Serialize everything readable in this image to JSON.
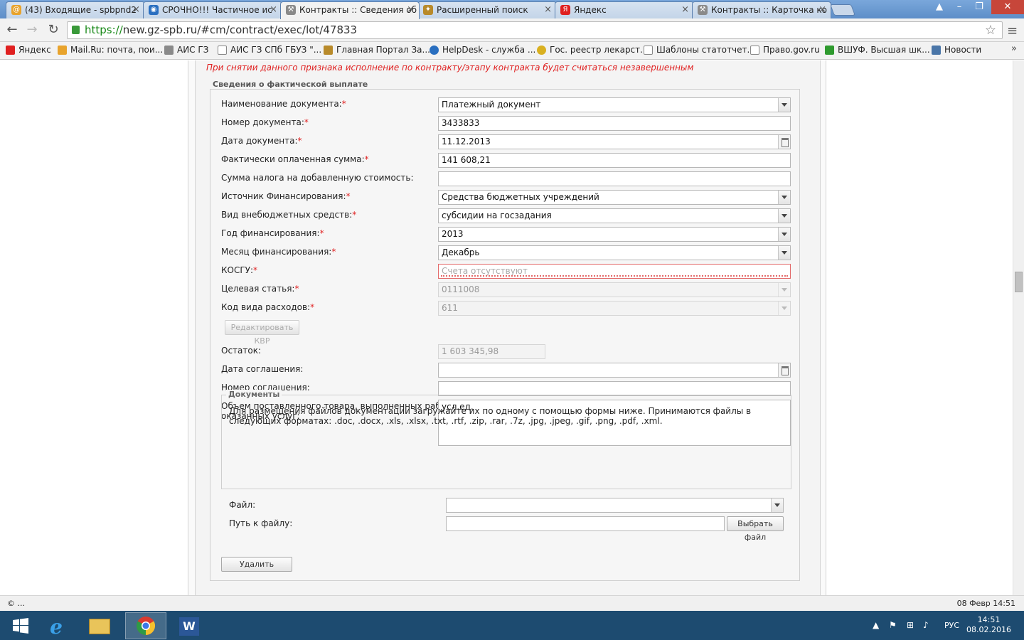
{
  "browser": {
    "tabs": [
      {
        "title": "(43) Входящие - spbpnd2",
        "favicon": "mail-icon",
        "color": "#e8a32c"
      },
      {
        "title": "СРОЧНО!!! Частичное ис",
        "favicon": "helpdesk-icon",
        "color": "#2a6fc0"
      },
      {
        "title": "Контракты :: Сведения об",
        "favicon": "tools-icon",
        "color": "#8a8a8a",
        "active": true
      },
      {
        "title": "Расширенный поиск",
        "favicon": "eagle-icon",
        "color": "#b88a2a"
      },
      {
        "title": "Яндекс",
        "favicon": "yandex-icon",
        "color": "#e02020"
      },
      {
        "title": "Контракты :: Карточка ко",
        "favicon": "tools-icon",
        "color": "#8a8a8a"
      }
    ],
    "url_scheme": "https://",
    "url_rest": "new.gz-spb.ru/#cm/contract/exec/lot/47833",
    "bookmarks": [
      {
        "label": "Яндекс",
        "color": "#e02020"
      },
      {
        "label": "Mail.Ru: почта, пои...",
        "color": "#e8a32c"
      },
      {
        "label": "АИС ГЗ",
        "color": "#8a8a8a"
      },
      {
        "label": "АИС ГЗ СПб ГБУЗ \"...",
        "color": "#ffffff"
      },
      {
        "label": "Главная Портал За...",
        "color": "#b88a2a"
      },
      {
        "label": "HelpDesk - служба ...",
        "color": "#2a6fc0"
      },
      {
        "label": "Гос. реестр лекарст...",
        "color": "#d9b020"
      },
      {
        "label": "Шаблоны статотчет...",
        "color": "#ffffff"
      },
      {
        "label": "Право.gov.ru",
        "color": "#ffffff"
      },
      {
        "label": "ВШУФ. Высшая шк...",
        "color": "#2e9a2e"
      },
      {
        "label": "Новости",
        "color": "#4a76a8"
      }
    ],
    "more": "»"
  },
  "page": {
    "warning": "При снятии данного признака исполнение по контракту/этапу контракта будет считаться незавершенным",
    "section_title": "Сведения о фактической выплате",
    "fields": {
      "doc_name": {
        "label": "Наименование документа:",
        "value": "Платежный документ"
      },
      "doc_number": {
        "label": "Номер документа:",
        "value": "3433833"
      },
      "doc_date": {
        "label": "Дата документа:",
        "value": "11.12.2013"
      },
      "paid_sum": {
        "label": "Фактически оплаченная сумма:",
        "value": "141 608,21"
      },
      "vat_sum": {
        "label": "Сумма налога на добавленную стоимость:",
        "value": ""
      },
      "fin_source": {
        "label": "Источник Финансирования:",
        "value": "Средства бюджетных учреждений"
      },
      "extra_budget": {
        "label": "Вид внебюджетных средств:",
        "value": "субсидии на госзадания"
      },
      "fin_year": {
        "label": "Год финансирования:",
        "value": "2013"
      },
      "fin_month": {
        "label": "Месяц финансирования:",
        "value": "Декабрь"
      },
      "kosgu": {
        "label": "КОСГУ:",
        "value": "Счета отсутствуют"
      },
      "target_article": {
        "label": "Целевая статья:",
        "value": "0111008"
      },
      "expense_code": {
        "label": "Код вида расходов:",
        "value": "611"
      },
      "remainder": {
        "label": "Остаток:",
        "value": "1 603 345,98"
      },
      "agreement_date": {
        "label": "Дата соглашения:",
        "value": ""
      },
      "agreement_number": {
        "label": "Номер соглашения:",
        "value": ""
      },
      "volume_line1": {
        "label": "Объем поставленного товара, выполненных работ,",
        "value": "усл.ед."
      },
      "volume_line2": {
        "label": "оказанных услуг:"
      }
    },
    "required_mark": "*",
    "edit_kvr_button": "Редактировать КВР",
    "documents": {
      "legend": "Документы",
      "info": "Для размещения файлов документации загружайте их по одному с помощью формы ниже. Принимаются файлы в следующих форматах: .doc, .docx, .xls, .xlsx, .txt, .rtf, .zip, .rar, .7z, .jpg, .jpeg, .gif, .png, .pdf, .xml.",
      "file_label": "Файл:",
      "file_value": "",
      "path_label": "Путь к файлу:",
      "path_value": "",
      "choose_button": "Выбрать файл"
    },
    "delete_button": "Удалить"
  },
  "statusbar": {
    "left": "© ...",
    "right": "08 Февр 14:51"
  },
  "taskbar": {
    "apps": [
      "start-icon",
      "ie-icon",
      "explorer-icon",
      "chrome-icon",
      "word-icon"
    ],
    "lang": "РУС",
    "time": "14:51",
    "date": "08.02.2016"
  }
}
